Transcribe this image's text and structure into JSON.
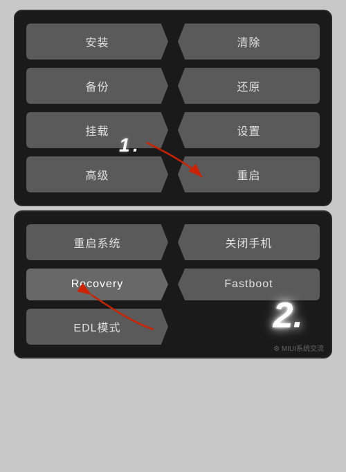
{
  "panel1": {
    "buttons": [
      {
        "label": "安装",
        "side": "left"
      },
      {
        "label": "清除",
        "side": "right"
      },
      {
        "label": "备份",
        "side": "left"
      },
      {
        "label": "还原",
        "side": "right"
      },
      {
        "label": "挂载",
        "side": "left"
      },
      {
        "label": "设置",
        "side": "right"
      },
      {
        "label": "高级",
        "side": "left"
      },
      {
        "label": "重启",
        "side": "right"
      }
    ],
    "step": "1"
  },
  "panel2": {
    "buttons": [
      {
        "label": "重启系统",
        "side": "left"
      },
      {
        "label": "关闭手机",
        "side": "right"
      },
      {
        "label": "Recovery",
        "side": "left"
      },
      {
        "label": "Fastboot",
        "side": "right"
      },
      {
        "label": "EDL模式",
        "side": "left"
      }
    ],
    "step": "2",
    "watermark": "⚙ MIUI系统交流"
  }
}
